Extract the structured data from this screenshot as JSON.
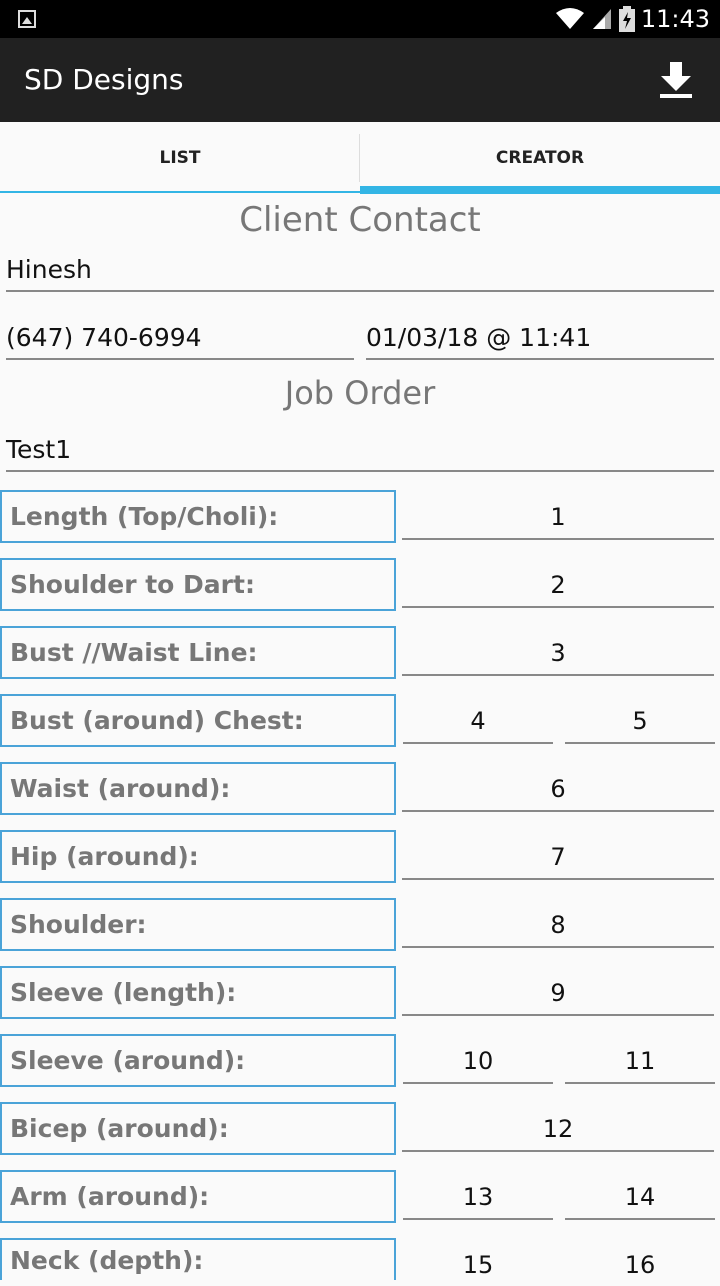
{
  "status": {
    "time": "11:43"
  },
  "app": {
    "title": "SD Designs"
  },
  "tabs": [
    {
      "label": "LIST"
    },
    {
      "label": "CREATOR"
    }
  ],
  "client": {
    "section_title": "Client Contact",
    "name": "Hinesh",
    "phone": "(647) 740-6994",
    "datetime": "01/03/18 @ 11:41"
  },
  "job": {
    "section_title": "Job Order",
    "name": "Test1"
  },
  "measurements": [
    {
      "label": "Length (Top/Choli):",
      "value": "1"
    },
    {
      "label": "Shoulder to Dart:",
      "value": "2"
    },
    {
      "label": "Bust //Waist Line:",
      "value": "3"
    },
    {
      "label": "Bust (around) Chest:",
      "value": "4",
      "value2": "5"
    },
    {
      "label": "Waist (around):",
      "value": "6"
    },
    {
      "label": "Hip (around):",
      "value": "7"
    },
    {
      "label": "Shoulder:",
      "value": "8"
    },
    {
      "label": "Sleeve (length):",
      "value": "9"
    },
    {
      "label": "Sleeve (around):",
      "value": "10",
      "value2": "11"
    },
    {
      "label": "Bicep (around):",
      "value": "12"
    },
    {
      "label": "Arm (around):",
      "value": "13",
      "value2": "14"
    },
    {
      "label": "Neck (depth):",
      "value": "15",
      "value2": "16"
    }
  ]
}
